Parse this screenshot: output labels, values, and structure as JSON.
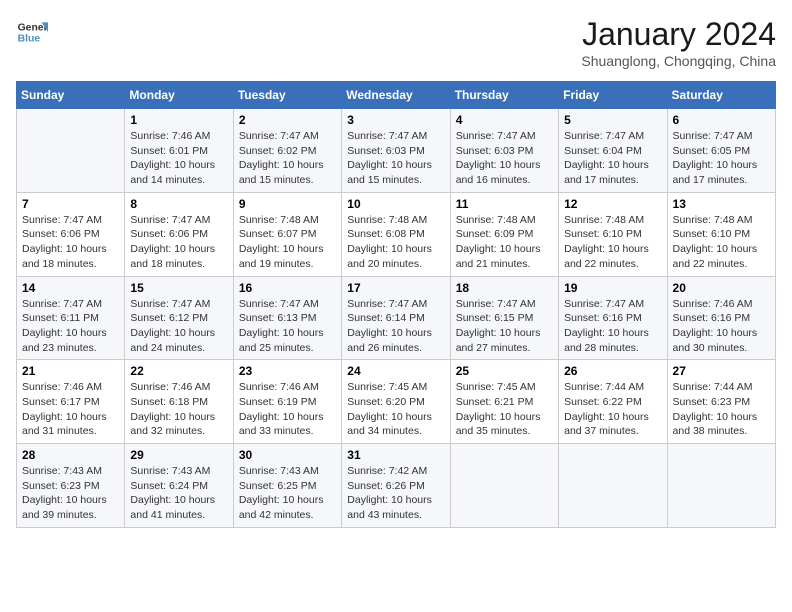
{
  "logo": {
    "text_general": "General",
    "text_blue": "Blue"
  },
  "title": "January 2024",
  "location": "Shuanglong, Chongqing, China",
  "days_of_week": [
    "Sunday",
    "Monday",
    "Tuesday",
    "Wednesday",
    "Thursday",
    "Friday",
    "Saturday"
  ],
  "weeks": [
    [
      {
        "day": "",
        "info": ""
      },
      {
        "day": "1",
        "info": "Sunrise: 7:46 AM\nSunset: 6:01 PM\nDaylight: 10 hours\nand 14 minutes."
      },
      {
        "day": "2",
        "info": "Sunrise: 7:47 AM\nSunset: 6:02 PM\nDaylight: 10 hours\nand 15 minutes."
      },
      {
        "day": "3",
        "info": "Sunrise: 7:47 AM\nSunset: 6:03 PM\nDaylight: 10 hours\nand 15 minutes."
      },
      {
        "day": "4",
        "info": "Sunrise: 7:47 AM\nSunset: 6:03 PM\nDaylight: 10 hours\nand 16 minutes."
      },
      {
        "day": "5",
        "info": "Sunrise: 7:47 AM\nSunset: 6:04 PM\nDaylight: 10 hours\nand 17 minutes."
      },
      {
        "day": "6",
        "info": "Sunrise: 7:47 AM\nSunset: 6:05 PM\nDaylight: 10 hours\nand 17 minutes."
      }
    ],
    [
      {
        "day": "7",
        "info": "Sunrise: 7:47 AM\nSunset: 6:06 PM\nDaylight: 10 hours\nand 18 minutes."
      },
      {
        "day": "8",
        "info": "Sunrise: 7:47 AM\nSunset: 6:06 PM\nDaylight: 10 hours\nand 18 minutes."
      },
      {
        "day": "9",
        "info": "Sunrise: 7:48 AM\nSunset: 6:07 PM\nDaylight: 10 hours\nand 19 minutes."
      },
      {
        "day": "10",
        "info": "Sunrise: 7:48 AM\nSunset: 6:08 PM\nDaylight: 10 hours\nand 20 minutes."
      },
      {
        "day": "11",
        "info": "Sunrise: 7:48 AM\nSunset: 6:09 PM\nDaylight: 10 hours\nand 21 minutes."
      },
      {
        "day": "12",
        "info": "Sunrise: 7:48 AM\nSunset: 6:10 PM\nDaylight: 10 hours\nand 22 minutes."
      },
      {
        "day": "13",
        "info": "Sunrise: 7:48 AM\nSunset: 6:10 PM\nDaylight: 10 hours\nand 22 minutes."
      }
    ],
    [
      {
        "day": "14",
        "info": "Sunrise: 7:47 AM\nSunset: 6:11 PM\nDaylight: 10 hours\nand 23 minutes."
      },
      {
        "day": "15",
        "info": "Sunrise: 7:47 AM\nSunset: 6:12 PM\nDaylight: 10 hours\nand 24 minutes."
      },
      {
        "day": "16",
        "info": "Sunrise: 7:47 AM\nSunset: 6:13 PM\nDaylight: 10 hours\nand 25 minutes."
      },
      {
        "day": "17",
        "info": "Sunrise: 7:47 AM\nSunset: 6:14 PM\nDaylight: 10 hours\nand 26 minutes."
      },
      {
        "day": "18",
        "info": "Sunrise: 7:47 AM\nSunset: 6:15 PM\nDaylight: 10 hours\nand 27 minutes."
      },
      {
        "day": "19",
        "info": "Sunrise: 7:47 AM\nSunset: 6:16 PM\nDaylight: 10 hours\nand 28 minutes."
      },
      {
        "day": "20",
        "info": "Sunrise: 7:46 AM\nSunset: 6:16 PM\nDaylight: 10 hours\nand 30 minutes."
      }
    ],
    [
      {
        "day": "21",
        "info": "Sunrise: 7:46 AM\nSunset: 6:17 PM\nDaylight: 10 hours\nand 31 minutes."
      },
      {
        "day": "22",
        "info": "Sunrise: 7:46 AM\nSunset: 6:18 PM\nDaylight: 10 hours\nand 32 minutes."
      },
      {
        "day": "23",
        "info": "Sunrise: 7:46 AM\nSunset: 6:19 PM\nDaylight: 10 hours\nand 33 minutes."
      },
      {
        "day": "24",
        "info": "Sunrise: 7:45 AM\nSunset: 6:20 PM\nDaylight: 10 hours\nand 34 minutes."
      },
      {
        "day": "25",
        "info": "Sunrise: 7:45 AM\nSunset: 6:21 PM\nDaylight: 10 hours\nand 35 minutes."
      },
      {
        "day": "26",
        "info": "Sunrise: 7:44 AM\nSunset: 6:22 PM\nDaylight: 10 hours\nand 37 minutes."
      },
      {
        "day": "27",
        "info": "Sunrise: 7:44 AM\nSunset: 6:23 PM\nDaylight: 10 hours\nand 38 minutes."
      }
    ],
    [
      {
        "day": "28",
        "info": "Sunrise: 7:43 AM\nSunset: 6:23 PM\nDaylight: 10 hours\nand 39 minutes."
      },
      {
        "day": "29",
        "info": "Sunrise: 7:43 AM\nSunset: 6:24 PM\nDaylight: 10 hours\nand 41 minutes."
      },
      {
        "day": "30",
        "info": "Sunrise: 7:43 AM\nSunset: 6:25 PM\nDaylight: 10 hours\nand 42 minutes."
      },
      {
        "day": "31",
        "info": "Sunrise: 7:42 AM\nSunset: 6:26 PM\nDaylight: 10 hours\nand 43 minutes."
      },
      {
        "day": "",
        "info": ""
      },
      {
        "day": "",
        "info": ""
      },
      {
        "day": "",
        "info": ""
      }
    ]
  ]
}
